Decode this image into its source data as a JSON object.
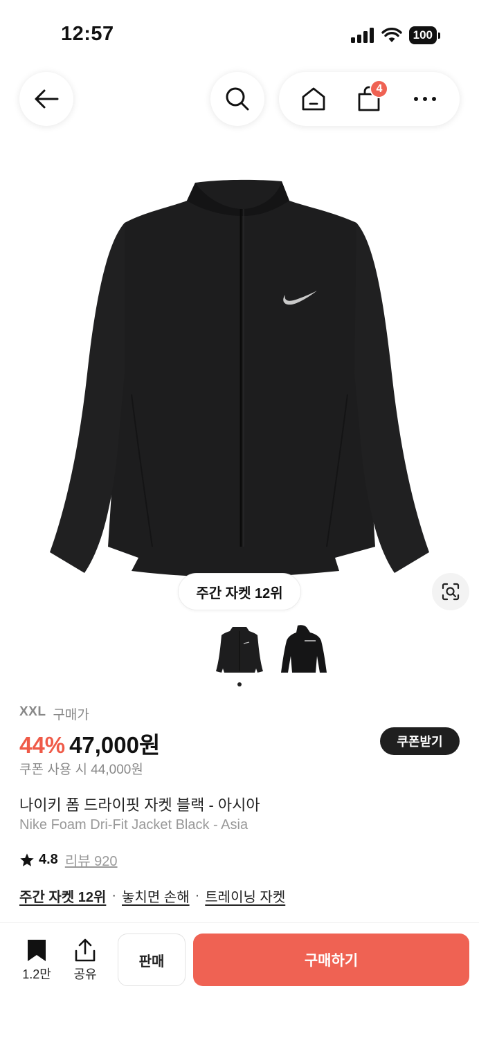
{
  "status_bar": {
    "time": "12:57",
    "battery": "100"
  },
  "nav": {
    "back_icon": "arrow-left-icon",
    "search_icon": "search-icon",
    "home_icon": "home-icon",
    "cart_icon": "shopping-bag-icon",
    "cart_count": "4",
    "more_icon": "more-horizontal-icon"
  },
  "product": {
    "rank_badge": "주간 자켓 12위",
    "image_count": 2,
    "active_image": 1,
    "size": "XXL",
    "size_label": "구매가",
    "discount": "44%",
    "price": "47,000원",
    "coupon_button": "쿠폰받기",
    "coupon_price": "쿠폰 사용 시 44,000원",
    "title_ko": "나이키 폼 드라이핏 자켓 블랙 - 아시아",
    "title_en": "Nike Foam Dri-Fit Jacket Black - Asia",
    "rating": "4.8",
    "review_link": "리뷰 920",
    "tags": [
      "주간 자켓 12위",
      "놓치면 손해",
      "트레이닝 자켓"
    ]
  },
  "bottom_bar": {
    "bookmark_count": "1.2만",
    "share_label": "공유",
    "sell_label": "판매",
    "buy_label": "구매하기"
  },
  "colors": {
    "accent": "#ef6253",
    "discount": "#ef5a48",
    "dark": "#1f1f1f"
  }
}
